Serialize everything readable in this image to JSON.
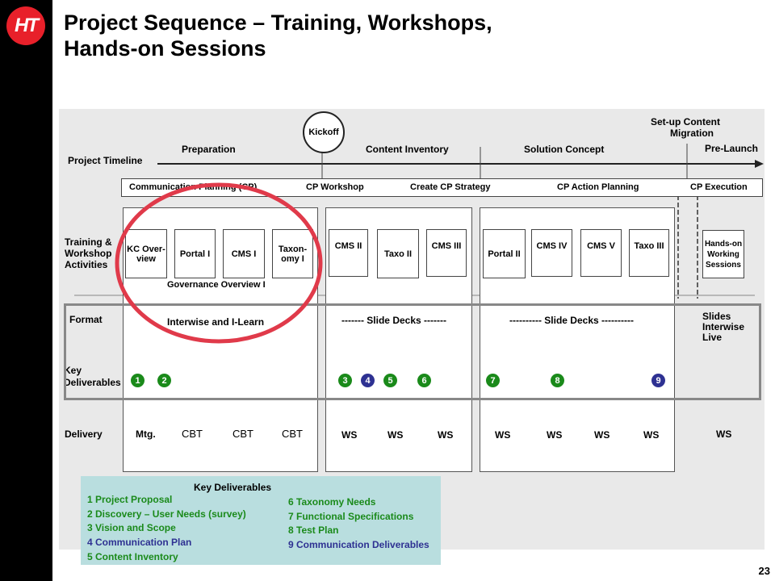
{
  "title_line1": "Project Sequence – Training, Workshops,",
  "title_line2": "Hands-on Sessions",
  "logo_text": "HT",
  "page_number": "23",
  "kickoff": "Kickoff",
  "timeline": {
    "label": "Project Timeline",
    "preparation": "Preparation",
    "content_inventory": "Content Inventory",
    "solution_concept": "Solution Concept",
    "setup_line1": "Set-up Content",
    "setup_line2": "Migration",
    "pre_launch": "Pre-Launch"
  },
  "cp_bar": [
    "Communication Planning (CP)",
    "CP Workshop",
    "Create CP Strategy",
    "CP Action Planning",
    "CP Execution"
  ],
  "row_labels": {
    "training_line1": "Training &",
    "training_line2": "Workshop",
    "training_line3": "Activities",
    "format": "Format",
    "key_line1": "Key",
    "key_line2": "Deliverables",
    "delivery": "Delivery"
  },
  "sessions": {
    "kc_line1": "KC Over-",
    "kc_line2": "view",
    "portal1": "Portal I",
    "cms1": "CMS I",
    "taxo_line1": "Taxon-",
    "taxo_line2": "omy I",
    "cms2": "CMS II",
    "taxo2": "Taxo II",
    "cms3": "CMS III",
    "portal2": "Portal II",
    "cms4": "CMS IV",
    "cms5": "CMS V",
    "taxo3": "Taxo III",
    "hands_line1": "Hands-on",
    "hands_line2": "Working",
    "hands_line3": "Sessions",
    "governance": "Governance Overview I"
  },
  "formats": {
    "group1": "Interwise and I-Learn",
    "group2": "-------  Slide Decks  -------",
    "group3": "----------  Slide Decks  ----------",
    "slides": "Slides",
    "interwise": "Interwise",
    "live": "Live"
  },
  "deliverable_badges": [
    "1",
    "2",
    "3",
    "4",
    "5",
    "6",
    "7",
    "8",
    "9"
  ],
  "delivery": [
    "Mtg.",
    "CBT",
    "CBT",
    "CBT",
    "WS",
    "WS",
    "WS",
    "WS",
    "WS",
    "WS",
    "WS",
    "WS"
  ],
  "legend": {
    "heading": "Key Deliverables",
    "items": [
      "1 Project Proposal",
      "2 Discovery – User Needs (survey)",
      "3 Vision and Scope",
      "4 Communication Plan",
      "5 Content Inventory",
      "6 Taxonomy Needs",
      "7 Functional Specifications",
      "8 Test Plan",
      "9 Communication Deliverables"
    ]
  },
  "colors": {
    "accent_red": "#e8202a",
    "green": "#1a8a1a",
    "blue": "#2e3192",
    "legend_bg": "#b9dedf"
  }
}
